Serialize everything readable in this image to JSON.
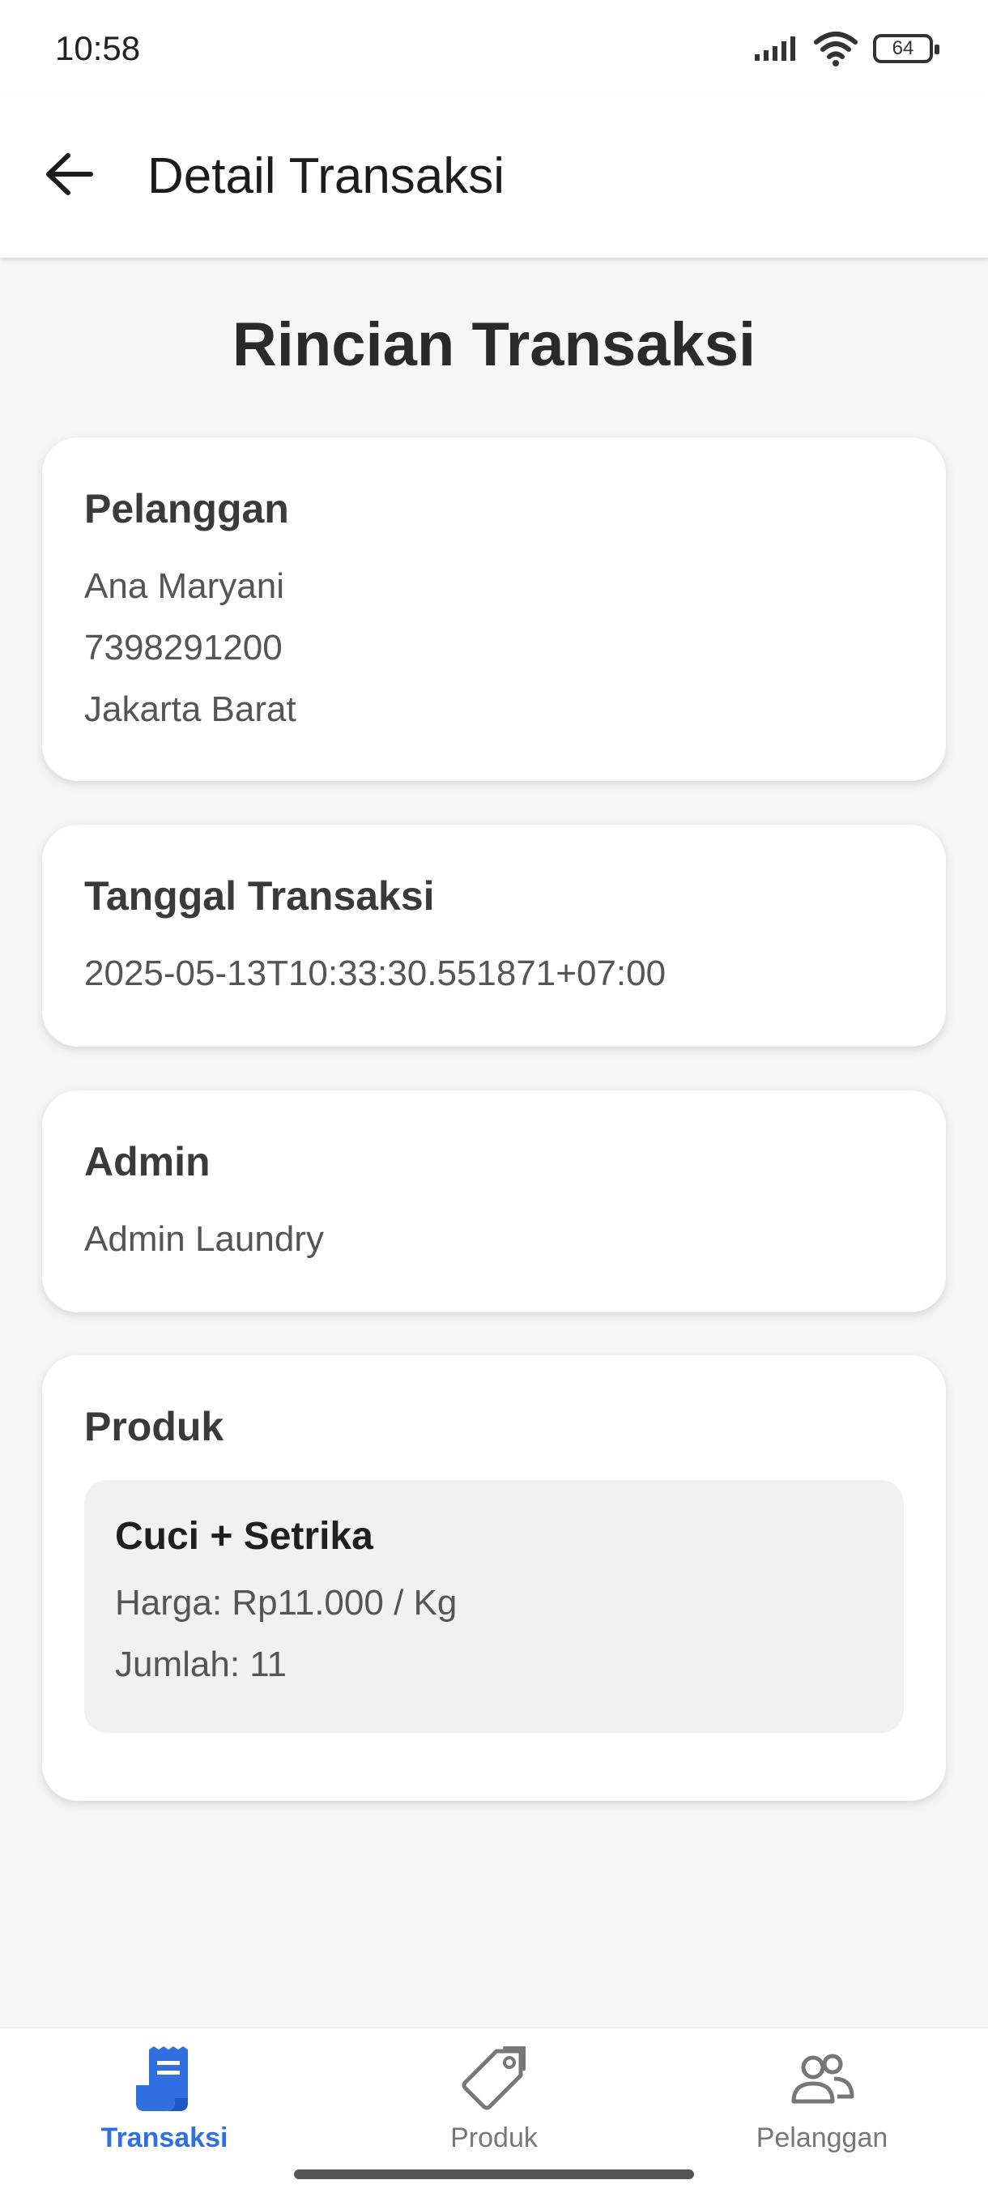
{
  "status_bar": {
    "time": "10:58",
    "battery": "64"
  },
  "app_bar": {
    "title": "Detail Transaksi"
  },
  "page": {
    "heading": "Rincian Transaksi"
  },
  "customer": {
    "title": "Pelanggan",
    "name": "Ana Maryani",
    "phone": "7398291200",
    "address": "Jakarta Barat"
  },
  "transaction_date": {
    "title": "Tanggal Transaksi",
    "value": "2025-05-13T10:33:30.551871+07:00"
  },
  "admin": {
    "title": "Admin",
    "name": "Admin Laundry"
  },
  "products": {
    "title": "Produk",
    "items": [
      {
        "name": "Cuci + Setrika",
        "price": "Harga: Rp11.000 / Kg",
        "quantity": "Jumlah: 11"
      }
    ]
  },
  "bottom_nav": {
    "items": [
      {
        "label": "Transaksi",
        "icon": "receipt-icon",
        "active": true
      },
      {
        "label": "Produk",
        "icon": "tag-icon",
        "active": false
      },
      {
        "label": "Pelanggan",
        "icon": "people-icon",
        "active": false
      }
    ]
  },
  "colors": {
    "accent": "#2f6fe0",
    "background": "#f6f6f6",
    "card": "#ffffff"
  }
}
